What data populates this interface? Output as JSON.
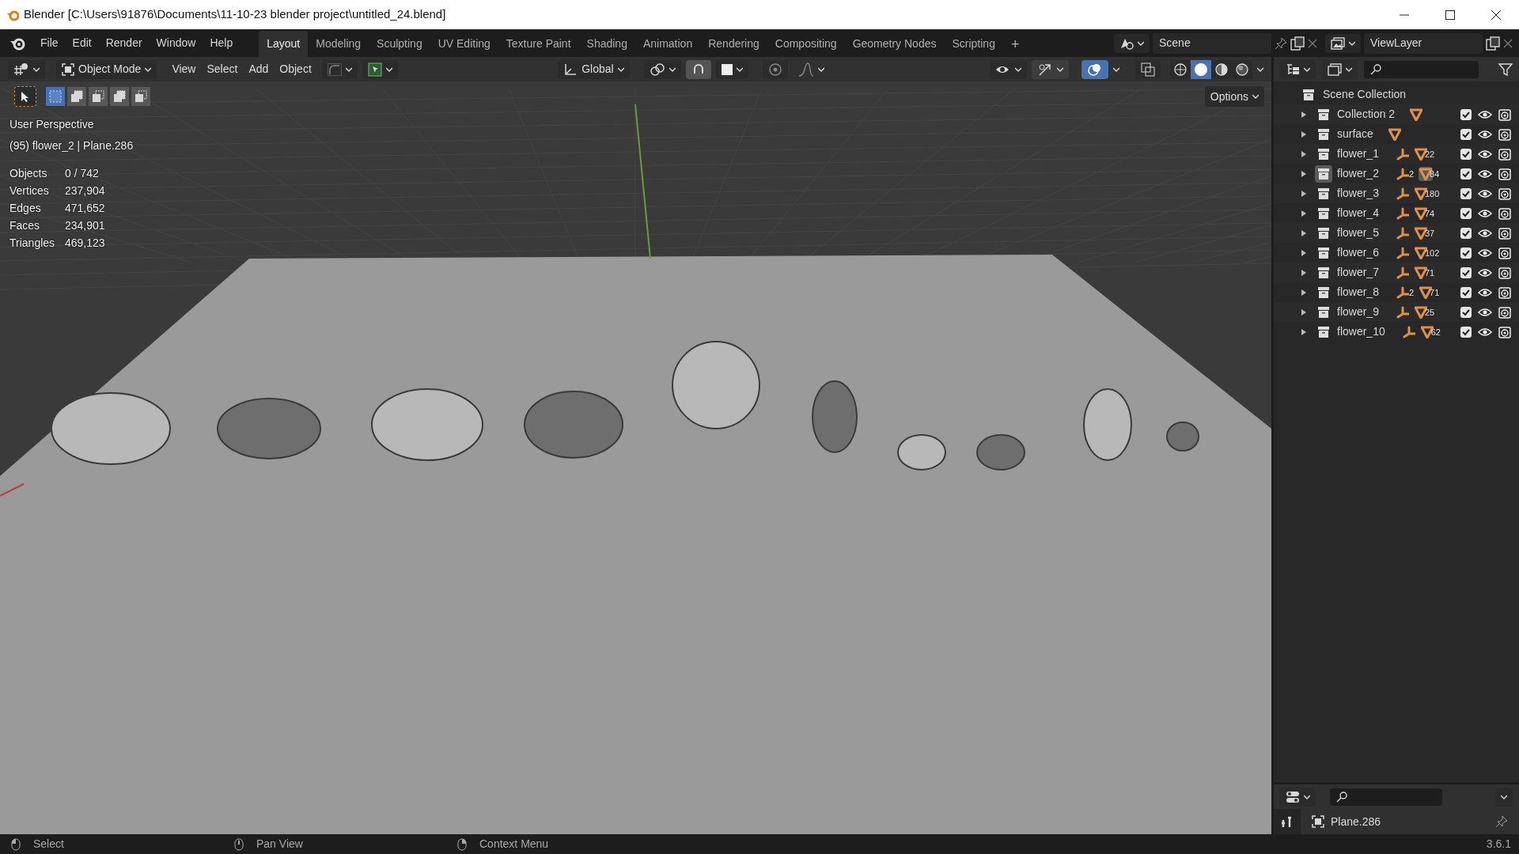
{
  "window": {
    "title": "Blender [C:\\Users\\91876\\Documents\\11-10-23 blender project\\untitled_24.blend]"
  },
  "menu": [
    "File",
    "Edit",
    "Render",
    "Window",
    "Help"
  ],
  "workspaces": [
    {
      "label": "Layout",
      "selected": true
    },
    {
      "label": "Modeling",
      "selected": false
    },
    {
      "label": "Sculpting",
      "selected": false
    },
    {
      "label": "UV Editing",
      "selected": false
    },
    {
      "label": "Texture Paint",
      "selected": false
    },
    {
      "label": "Shading",
      "selected": false
    },
    {
      "label": "Animation",
      "selected": false
    },
    {
      "label": "Rendering",
      "selected": false
    },
    {
      "label": "Compositing",
      "selected": false
    },
    {
      "label": "Geometry Nodes",
      "selected": false
    },
    {
      "label": "Scripting",
      "selected": false
    }
  ],
  "add_workspace": "+",
  "scene": {
    "name": "Scene"
  },
  "view_layer": {
    "name": "ViewLayer"
  },
  "viewport": {
    "mode": "Object Mode",
    "menus": [
      "View",
      "Select",
      "Add",
      "Object"
    ],
    "orientation": "Global",
    "options": "Options",
    "view_name": "User Perspective",
    "active": "(95) flower_2 | Plane.286",
    "stats": [
      {
        "label": "Objects",
        "value": "0 / 742"
      },
      {
        "label": "Vertices",
        "value": "237,904"
      },
      {
        "label": "Edges",
        "value": "471,652"
      },
      {
        "label": "Faces",
        "value": "234,901"
      },
      {
        "label": "Triangles",
        "value": "469,123"
      }
    ]
  },
  "outliner": {
    "root": "Scene Collection",
    "items": [
      {
        "name": "Collection 2",
        "armature": false,
        "highlighted": false,
        "checked": true
      },
      {
        "name": "surface",
        "armature": false,
        "highlighted": false,
        "checked": true
      },
      {
        "name": "flower_1",
        "armature": true,
        "mesh_count": "22",
        "highlighted": false,
        "checked": true
      },
      {
        "name": "flower_2",
        "armature": true,
        "armature_count": "2",
        "mesh_count": "84",
        "highlighted": true,
        "checked": true
      },
      {
        "name": "flower_3",
        "armature": true,
        "mesh_count": "180",
        "highlighted": false,
        "checked": true
      },
      {
        "name": "flower_4",
        "armature": true,
        "mesh_count": "74",
        "highlighted": false,
        "checked": true
      },
      {
        "name": "flower_5",
        "armature": true,
        "mesh_count": "37",
        "highlighted": false,
        "checked": true
      },
      {
        "name": "flower_6",
        "armature": true,
        "mesh_count": "102",
        "highlighted": false,
        "checked": true
      },
      {
        "name": "flower_7",
        "armature": true,
        "mesh_count": "71",
        "highlighted": false,
        "checked": true
      },
      {
        "name": "flower_8",
        "armature": true,
        "armature_count": "2",
        "mesh_count": "71",
        "highlighted": false,
        "checked": true
      },
      {
        "name": "flower_9",
        "armature": true,
        "mesh_count": "25",
        "highlighted": false,
        "checked": true
      },
      {
        "name": "flower_10",
        "armature": true,
        "mesh_count": "62",
        "highlighted": false,
        "checked": true
      }
    ]
  },
  "properties": {
    "object": "Plane.286"
  },
  "status_bar": {
    "hints": [
      "Select",
      "Pan View",
      "Context Menu"
    ],
    "version": "3.6.1"
  }
}
